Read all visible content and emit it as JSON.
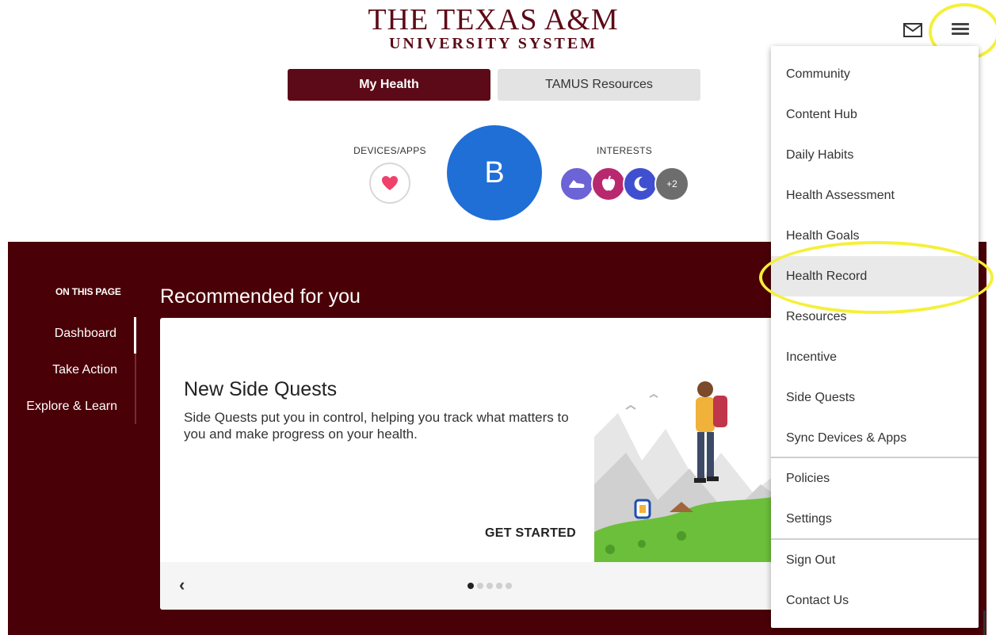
{
  "header": {
    "logo_line1": "THE TEXAS A&M",
    "logo_line2": "UNIVERSITY SYSTEM",
    "mail_icon": "mail-icon",
    "menu_icon": "hamburger-menu-icon"
  },
  "tabs": [
    {
      "label": "My Health",
      "active": true
    },
    {
      "label": "TAMUS Resources",
      "active": false
    }
  ],
  "profile": {
    "devices_label": "DEVICES/APPS",
    "devices_icon": "heart-icon",
    "avatar_initial": "B",
    "interests_label": "INTERESTS",
    "interests_icons": [
      "shoe-icon",
      "apple-icon",
      "moon-icon"
    ],
    "interests_more": "+2"
  },
  "sidebar": {
    "section_label": "ON THIS PAGE",
    "items": [
      {
        "label": "Dashboard",
        "active": true
      },
      {
        "label": "Take Action",
        "active": false
      },
      {
        "label": "Explore & Learn",
        "active": false
      }
    ]
  },
  "main": {
    "section_title": "Recommended for you",
    "card": {
      "title": "New Side Quests",
      "description": "Side Quests put you in control, helping you track what matters to you and make progress on your health.",
      "cta": "GET STARTED",
      "prev_icon": "chevron-left-icon",
      "dots_total": 5,
      "dots_active_index": 0
    }
  },
  "menu": {
    "items": [
      {
        "label": "Community"
      },
      {
        "label": "Content Hub"
      },
      {
        "label": "Daily Habits"
      },
      {
        "label": "Health Assessment"
      },
      {
        "label": "Health Goals"
      },
      {
        "label": "Health Record",
        "highlighted": true
      },
      {
        "label": "Resources"
      },
      {
        "label": "Incentive"
      },
      {
        "label": "Side Quests"
      },
      {
        "label": "Sync Devices & Apps"
      },
      {
        "label": "Policies"
      },
      {
        "label": "Settings"
      },
      {
        "label": "Sign Out"
      },
      {
        "label": "Contact Us"
      }
    ]
  },
  "colors": {
    "brand_maroon": "#5c0a17",
    "section_bg": "#4a0007",
    "avatar_blue": "#1f6fd6",
    "annotation_yellow": "#f5f03a"
  }
}
